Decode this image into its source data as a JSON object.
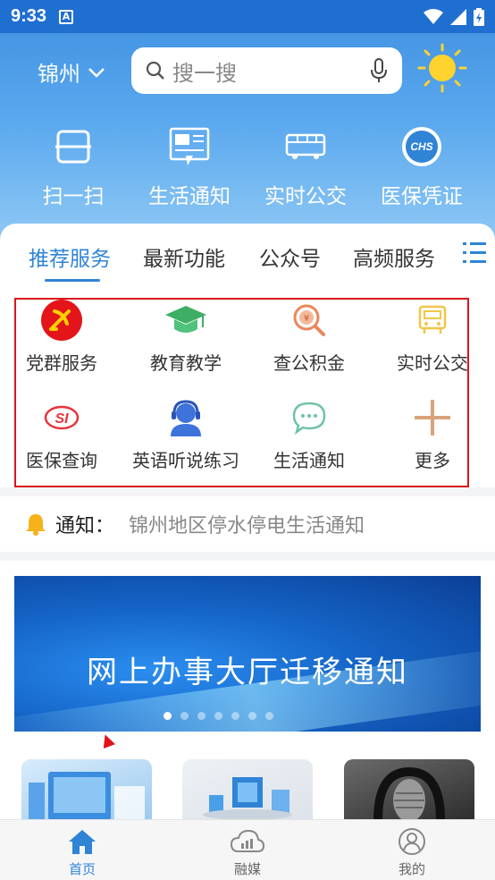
{
  "status_bar": {
    "time": "9:33",
    "notification_icon": "a-icon"
  },
  "header": {
    "city": "锦州",
    "search_placeholder": "搜一搜",
    "quick_actions": [
      {
        "label": "扫一扫",
        "icon": "scan-icon"
      },
      {
        "label": "生活通知",
        "icon": "newspaper-icon"
      },
      {
        "label": "实时公交",
        "icon": "bus-icon"
      },
      {
        "label": "医保凭证",
        "icon": "chs-icon",
        "badge": "CHS"
      }
    ]
  },
  "tabs": [
    {
      "label": "推荐服务",
      "active": true
    },
    {
      "label": "最新功能"
    },
    {
      "label": "公众号"
    },
    {
      "label": "高频服务"
    }
  ],
  "services": [
    {
      "label": "党群服务",
      "icon": "party-emblem-icon"
    },
    {
      "label": "教育教学",
      "icon": "graduation-cap-icon"
    },
    {
      "label": "查公积金",
      "icon": "fund-search-icon",
      "glyph": "¥"
    },
    {
      "label": "实时公交",
      "icon": "bus-icon"
    },
    {
      "label": "医保查询",
      "icon": "si-icon",
      "glyph": "SI"
    },
    {
      "label": "英语听说练习",
      "icon": "headset-user-icon"
    },
    {
      "label": "生活通知",
      "icon": "chat-bubble-icon"
    },
    {
      "label": "更多",
      "icon": "plus-icon"
    }
  ],
  "notice": {
    "label": "通知：",
    "text": "锦州地区停水停电生活通知"
  },
  "banner": {
    "title": "网上办事大厅迁移通知",
    "dots": 7,
    "active_dot": 0
  },
  "bottom_nav": [
    {
      "label": "首页",
      "icon": "home-icon",
      "active": true
    },
    {
      "label": "融媒",
      "icon": "cloud-chart-icon"
    },
    {
      "label": "我的",
      "icon": "user-icon"
    }
  ],
  "colors": {
    "accent": "#2f84d6",
    "header_top": "#3d8fe0",
    "highlight_frame": "#d9161d"
  }
}
